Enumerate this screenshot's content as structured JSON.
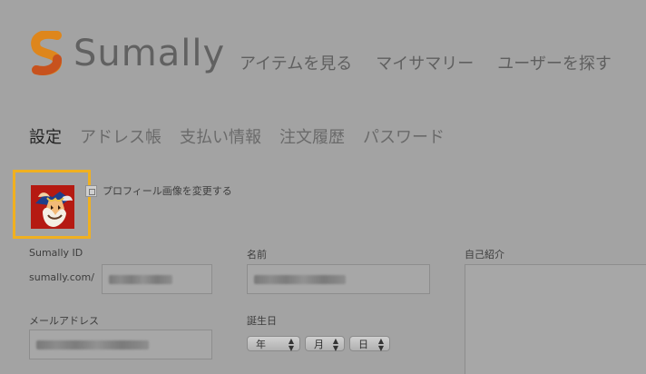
{
  "brand": {
    "name": "Sumally"
  },
  "top_nav": [
    "アイテムを見る",
    "マイサマリー",
    "ユーザーを探す"
  ],
  "settings_tabs": [
    {
      "label": "設定",
      "active": true
    },
    {
      "label": "アドレス帳",
      "active": false
    },
    {
      "label": "支払い情報",
      "active": false
    },
    {
      "label": "注文履歴",
      "active": false
    },
    {
      "label": "パスワード",
      "active": false
    }
  ],
  "profile": {
    "change_image_label": "プロフィール画像を変更する"
  },
  "form": {
    "sumally_id_label": "Sumally ID",
    "url_prefix": "sumally.com/",
    "name_label": "名前",
    "bio_label": "自己紹介",
    "email_label": "メールアドレス",
    "birthday_label": "誕生日",
    "birthday": {
      "year": "年",
      "month": "月",
      "day": "日"
    }
  },
  "colors": {
    "overlay_gray": "#a3a3a3",
    "brand_orange": "#e8a11f",
    "brand_red": "#d64a1b",
    "avatar_frame": "#f0b020"
  },
  "icons": [
    "sumally-logo-icon",
    "change-photo-icon",
    "avatar-image"
  ]
}
